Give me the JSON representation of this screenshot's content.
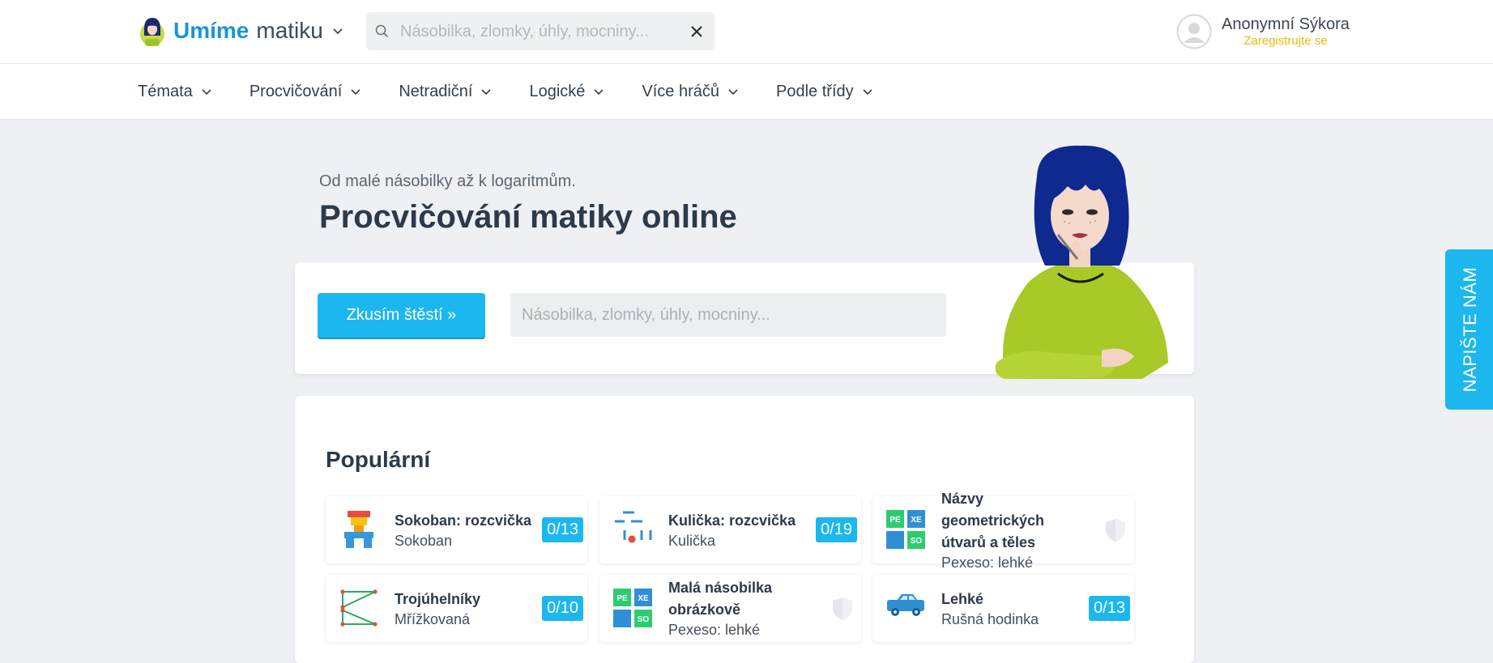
{
  "brand": {
    "name_bold": "Umíme",
    "name_rest": "matiku"
  },
  "top_search": {
    "placeholder": "Násobilka, zlomky, úhly, mocniny..."
  },
  "user": {
    "name": "Anonymní Sýkora",
    "register": "Zaregistrujte se"
  },
  "nav": {
    "items": [
      {
        "label": "Témata"
      },
      {
        "label": "Procvičování"
      },
      {
        "label": "Netradiční"
      },
      {
        "label": "Logické"
      },
      {
        "label": "Více hráčů"
      },
      {
        "label": "Podle třídy"
      }
    ]
  },
  "hero": {
    "subtitle": "Od malé násobilky až k logaritmům.",
    "title": "Procvičování matiky online",
    "luck_button": "Zkusím štěstí  »",
    "search_placeholder": "Násobilka, zlomky, úhly, mocniny..."
  },
  "popular": {
    "title": "Populární",
    "tiles": [
      {
        "name": "Sokoban: rozcvička",
        "category": "Sokoban",
        "badge": "0/13",
        "icon": "sokoban-icon"
      },
      {
        "name": "Kulička: rozcvička",
        "category": "Kulička",
        "badge": "0/19",
        "icon": "ball-game-icon"
      },
      {
        "name": "Názvy geometrických útvarů a těles",
        "category": "Pexeso: lehké",
        "badge": "",
        "icon": "pexeso-icon"
      },
      {
        "name": "Trojúhelníky",
        "category": "Mřížkovaná",
        "badge": "0/10",
        "icon": "triangles-icon"
      },
      {
        "name": "Malá násobilka obrázkově",
        "category": "Pexeso: lehké",
        "badge": "",
        "icon": "pexeso-icon"
      },
      {
        "name": "Lehké",
        "category": "Rušná hodinka",
        "badge": "0/13",
        "icon": "car-icon"
      }
    ]
  },
  "feedback": {
    "label": "NAPIŠTE NÁM"
  },
  "colors": {
    "accent": "#1cb7ee",
    "brand": "#1a96d4",
    "register": "#f2b705",
    "background": "#eff0f3"
  }
}
